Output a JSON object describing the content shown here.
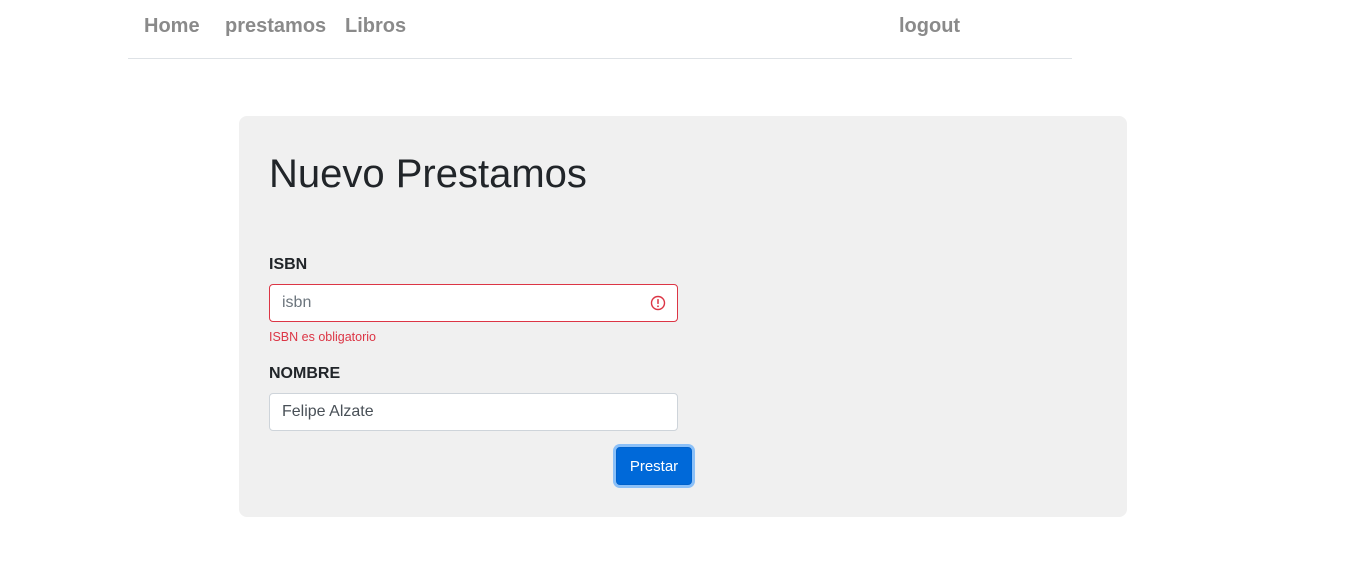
{
  "nav": {
    "home": "Home",
    "prestamos": "prestamos",
    "libros": "Libros",
    "logout": "logout"
  },
  "form": {
    "title": "Nuevo Prestamos",
    "isbn": {
      "label": "ISBN",
      "placeholder": "isbn",
      "value": "",
      "error": "ISBN es obligatorio",
      "error_icon": "exclamation-circle-icon"
    },
    "nombre": {
      "label": "NOMBRE",
      "value": "Felipe Alzate"
    },
    "submit_label": "Prestar"
  },
  "colors": {
    "error": "#dc3545",
    "primary": "#0069d9",
    "card_bg": "#f0f0f0",
    "nav_link": "#8a8a8a"
  }
}
